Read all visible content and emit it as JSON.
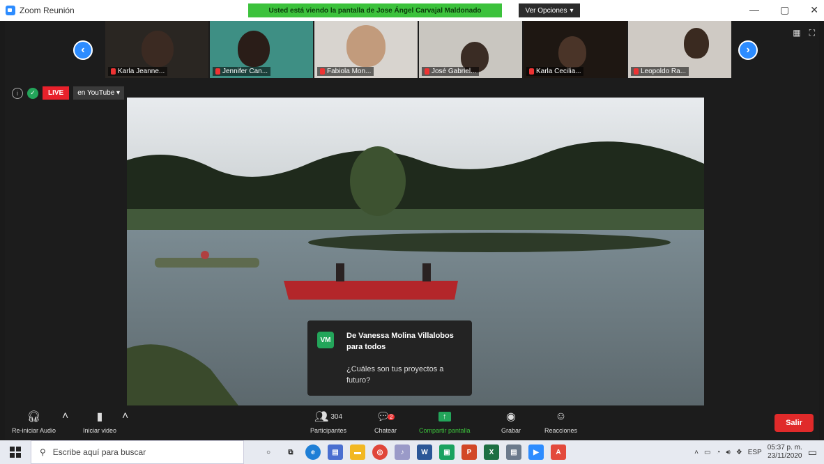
{
  "window": {
    "title": "Zoom Reunión",
    "share_banner": "Usted está viendo la pantalla de Jose Ángel Carvajal Maldonado",
    "view_options": "Ver Opciones",
    "minimize": "—",
    "maximize": "▢",
    "close": "✕"
  },
  "participants_strip": [
    {
      "name": "Karla Jeanne..."
    },
    {
      "name": "Jennifer Can..."
    },
    {
      "name": "Fabiola Mon..."
    },
    {
      "name": "José Gabriel..."
    },
    {
      "name": "Karla Cecilia..."
    },
    {
      "name": "Leopoldo Ra..."
    }
  ],
  "live": {
    "badge": "LIVE",
    "destination": "en YouTube"
  },
  "chat_popup": {
    "avatar_initials": "VM",
    "from": "De Vanessa Molina Villalobos para todos",
    "message": "¿Cuáles son tus proyectos a futuro?"
  },
  "toolbar": {
    "audio": "Re-iniciar Audio",
    "video": "Iniciar video",
    "participants": "Participantes",
    "participants_count": "304",
    "chat": "Chatear",
    "chat_badge": "2",
    "share": "Compartir pantalla",
    "record": "Grabar",
    "reactions": "Reacciones",
    "leave": "Salir"
  },
  "taskbar": {
    "search_placeholder": "Escribe aquí para buscar",
    "language": "ESP",
    "time": "05:37 p. m.",
    "date": "23/11/2020"
  },
  "colors": {
    "zoom_blue": "#2d8cff",
    "banner_green": "#3cc23c",
    "live_red": "#e8212b",
    "leave_red": "#e02a2a"
  }
}
